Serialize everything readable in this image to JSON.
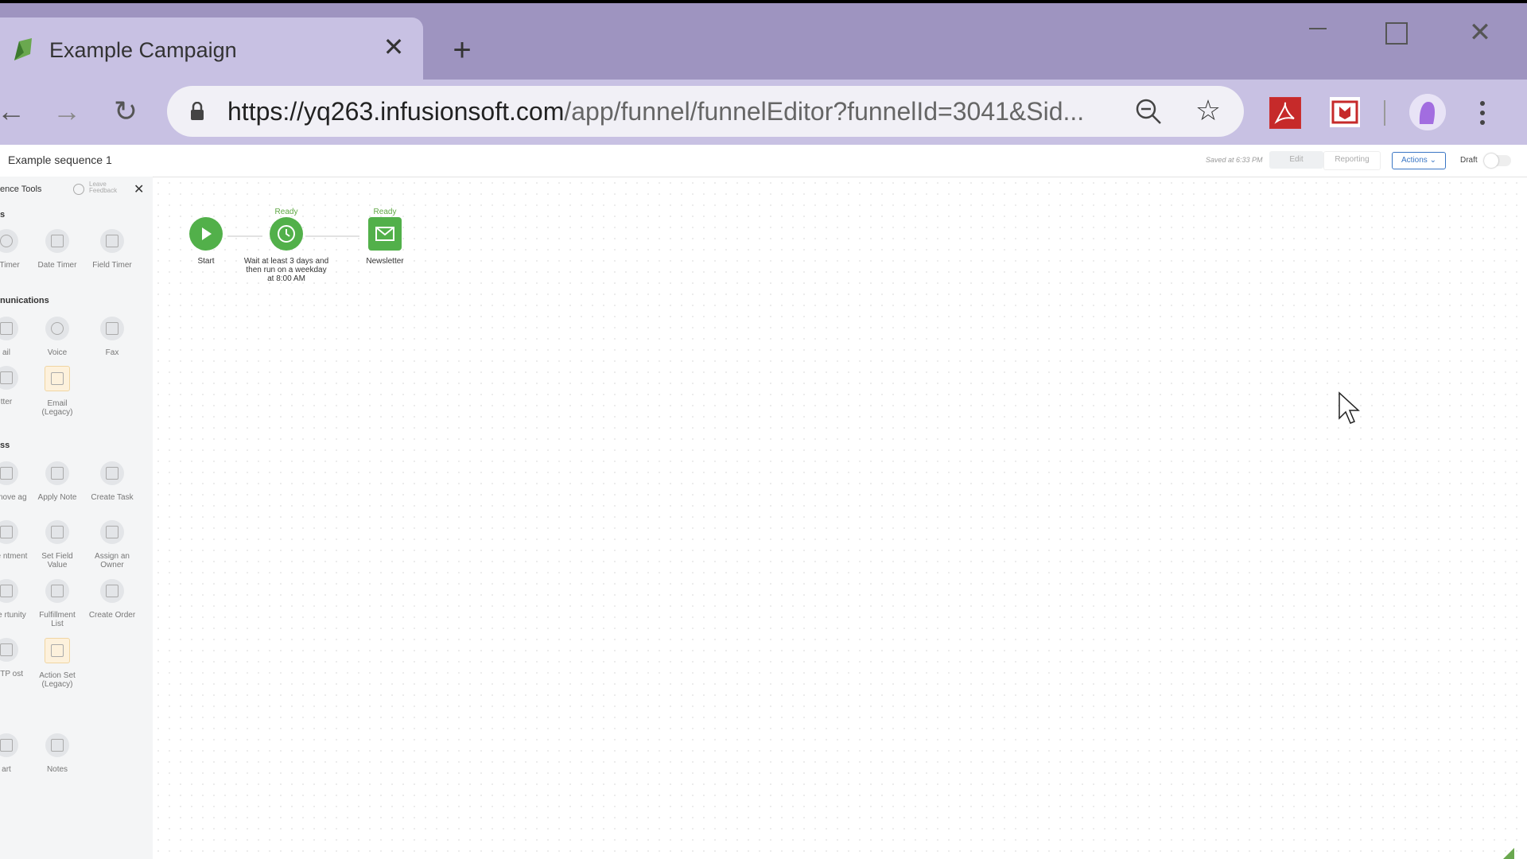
{
  "browser": {
    "tab_title": "Example Campaign",
    "url_domain": "https://yq263.infusionsoft.com",
    "url_path": "/app/funnel/funnelEditor?funnelId=3041&Sid..."
  },
  "header": {
    "sequence_name": "Example sequence 1",
    "saved_text": "Saved at 6:33 PM",
    "tab_edit": "Edit",
    "tab_reporting": "Reporting",
    "actions_label": "Actions ⌄",
    "draft_label": "Draft"
  },
  "sidebar": {
    "title": "ence Tools",
    "feedback": "Leave Feedback",
    "sections": {
      "timers": "s",
      "communications": "nunications",
      "process": "ss"
    },
    "timers": [
      {
        "label": "e Timer"
      },
      {
        "label": "Date Timer"
      },
      {
        "label": "Field Timer"
      }
    ],
    "communications": [
      {
        "label": "ail"
      },
      {
        "label": "Voice"
      },
      {
        "label": "Fax"
      },
      {
        "label": "tter"
      },
      {
        "label": "Email (Legacy)"
      }
    ],
    "process": [
      {
        "label": "Remove ag"
      },
      {
        "label": "Apply Note"
      },
      {
        "label": "Create Task"
      },
      {
        "label": "eate ntment"
      },
      {
        "label": "Set Field Value"
      },
      {
        "label": "Assign an Owner"
      },
      {
        "label": "eate rtunity"
      },
      {
        "label": "Fulfillment List"
      },
      {
        "label": "Create Order"
      },
      {
        "label": "HTTP ost"
      },
      {
        "label": "Action Set (Legacy)"
      }
    ],
    "other": [
      {
        "label": "art"
      },
      {
        "label": "Notes"
      }
    ]
  },
  "canvas": {
    "nodes": [
      {
        "status": "",
        "label": "Start",
        "icon": "play-icon"
      },
      {
        "status": "Ready",
        "label": "Wait at least 3 days and then run on a weekday at 8:00 AM",
        "icon": "clock-icon"
      },
      {
        "status": "Ready",
        "label": "Newsletter",
        "icon": "envelope-icon"
      }
    ]
  },
  "colors": {
    "node_green": "#52b04a",
    "chrome_purple": "#9e94c0",
    "tab_lavender": "#c8c1e3",
    "actions_blue": "#3a76c4"
  }
}
